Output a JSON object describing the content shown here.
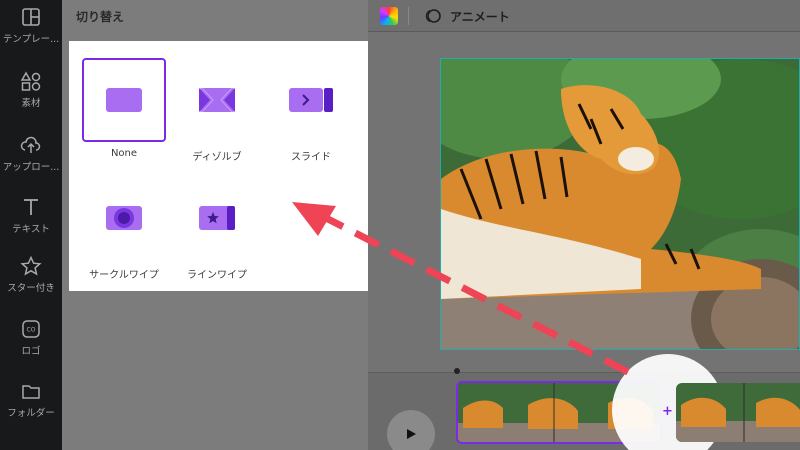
{
  "sidebar": {
    "items": [
      {
        "label": "テンプレー...",
        "icon": "template-icon"
      },
      {
        "label": "素材",
        "icon": "elements-icon"
      },
      {
        "label": "アップロー...",
        "icon": "upload-icon"
      },
      {
        "label": "テキスト",
        "icon": "text-icon"
      },
      {
        "label": "スター付き",
        "icon": "star-icon"
      },
      {
        "label": "ロゴ",
        "icon": "logo-icon"
      },
      {
        "label": "フォルダー",
        "icon": "folder-icon"
      }
    ]
  },
  "panel": {
    "title": "切り替え",
    "options": [
      {
        "label": "None",
        "icon": "none-transition-icon",
        "selected": true
      },
      {
        "label": "ディゾルブ",
        "icon": "dissolve-transition-icon",
        "selected": false
      },
      {
        "label": "スライド",
        "icon": "slide-transition-icon",
        "selected": false
      },
      {
        "label": "サークルワイプ",
        "icon": "circle-wipe-transition-icon",
        "selected": false
      },
      {
        "label": "ラインワイプ",
        "icon": "line-wipe-transition-icon",
        "selected": false
      }
    ]
  },
  "toolbar": {
    "animate_label": "アニメート"
  },
  "colors": {
    "accent": "#7d2ae8",
    "tile_purple": "#a86df0",
    "tile_dark": "#6b22d6",
    "arrow": "#ee4456",
    "frame": "#22aab0"
  }
}
